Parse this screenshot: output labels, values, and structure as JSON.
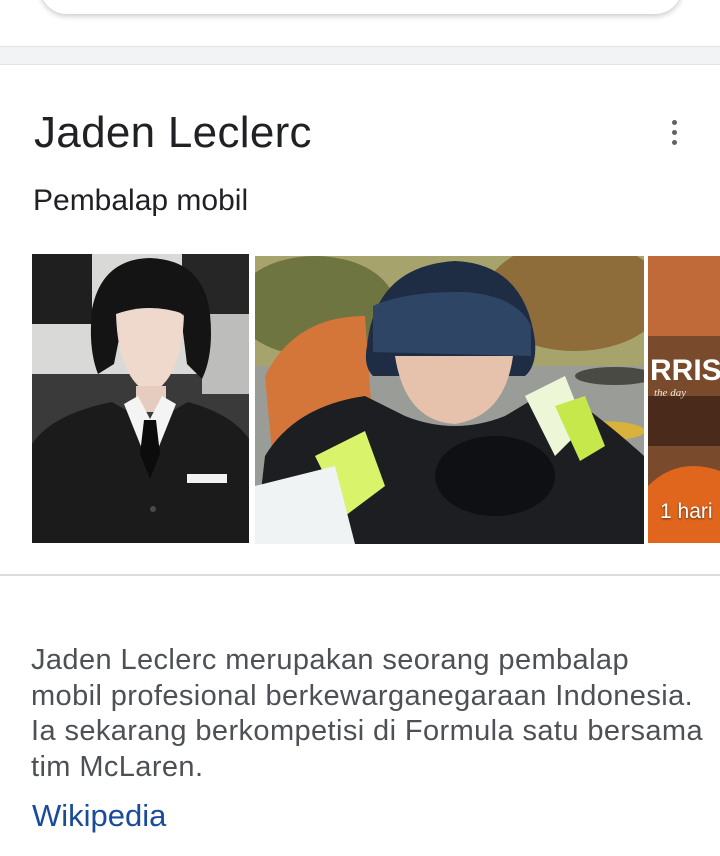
{
  "header": {
    "title": "Jaden Leclerc",
    "subtitle": "Pembalap mobil",
    "more_icon": "more-vertical-icon"
  },
  "images": {
    "items": [
      {
        "alt": "portrait-in-suit"
      },
      {
        "alt": "rider-in-helmet"
      },
      {
        "alt": "partial-poster"
      }
    ],
    "time_badge": "1 hari"
  },
  "description": {
    "text": "Jaden Leclerc merupakan seorang pembalap mobil profesional berkewarganegaraan Indonesia. Ia sekarang berkompetisi di Formula satu bersama tim McLaren.",
    "source_label": "Wikipedia"
  },
  "colors": {
    "title": "#202124",
    "body_text": "#4d5156",
    "link": "#1a4a9c",
    "divider": "#dadce0"
  }
}
